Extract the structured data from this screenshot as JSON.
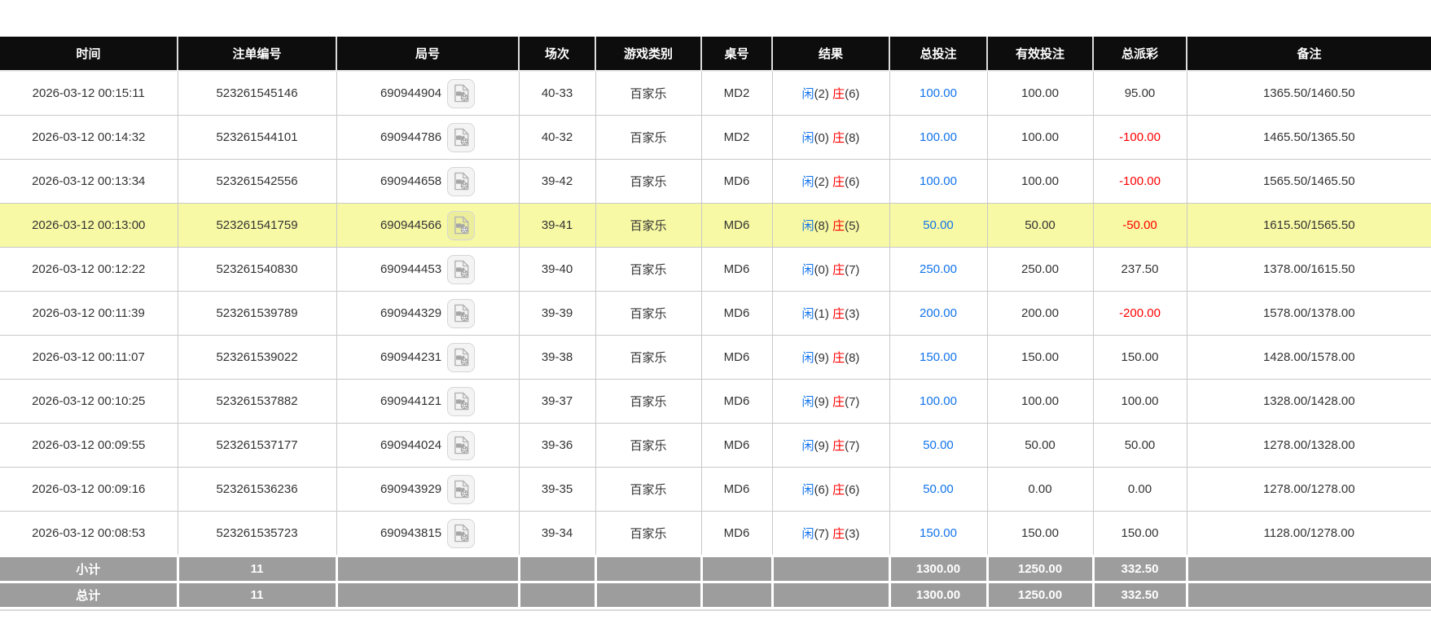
{
  "colors": {
    "bet_blue": "#1273eb",
    "loss_red": "#fe0000",
    "highlight_yellow": "#f8f9a4",
    "header_black": "#0d0d0d",
    "footer_gray": "#9d9d9d"
  },
  "table": {
    "headers": [
      "时间",
      "注单编号",
      "局号",
      "场次",
      "游戏类别",
      "桌号",
      "结果",
      "总投注",
      "有效投注",
      "总派彩",
      "备注"
    ],
    "video_icon": "video-file-icon",
    "rows": [
      {
        "time": "2026-03-12 00:15:11",
        "order_no": "523261545146",
        "round_no": "690944904",
        "session": "40-33",
        "game_type": "百家乐",
        "table_no": "MD2",
        "result": {
          "player_label": "闲",
          "player_score": "(2)",
          "banker_label": "庄",
          "banker_score": "(6)"
        },
        "total_bet": "100.00",
        "valid_bet": "100.00",
        "payout": "95.00",
        "remark": "1365.50/1460.50",
        "highlighted": false
      },
      {
        "time": "2026-03-12 00:14:32",
        "order_no": "523261544101",
        "round_no": "690944786",
        "session": "40-32",
        "game_type": "百家乐",
        "table_no": "MD2",
        "result": {
          "player_label": "闲",
          "player_score": "(0)",
          "banker_label": "庄",
          "banker_score": "(8)"
        },
        "total_bet": "100.00",
        "valid_bet": "100.00",
        "payout": "-100.00",
        "remark": "1465.50/1365.50",
        "highlighted": false
      },
      {
        "time": "2026-03-12 00:13:34",
        "order_no": "523261542556",
        "round_no": "690944658",
        "session": "39-42",
        "game_type": "百家乐",
        "table_no": "MD6",
        "result": {
          "player_label": "闲",
          "player_score": "(2)",
          "banker_label": "庄",
          "banker_score": "(6)"
        },
        "total_bet": "100.00",
        "valid_bet": "100.00",
        "payout": "-100.00",
        "remark": "1565.50/1465.50",
        "highlighted": false
      },
      {
        "time": "2026-03-12 00:13:00",
        "order_no": "523261541759",
        "round_no": "690944566",
        "session": "39-41",
        "game_type": "百家乐",
        "table_no": "MD6",
        "result": {
          "player_label": "闲",
          "player_score": "(8)",
          "banker_label": "庄",
          "banker_score": "(5)"
        },
        "total_bet": "50.00",
        "valid_bet": "50.00",
        "payout": "-50.00",
        "remark": "1615.50/1565.50",
        "highlighted": true
      },
      {
        "time": "2026-03-12 00:12:22",
        "order_no": "523261540830",
        "round_no": "690944453",
        "session": "39-40",
        "game_type": "百家乐",
        "table_no": "MD6",
        "result": {
          "player_label": "闲",
          "player_score": "(0)",
          "banker_label": "庄",
          "banker_score": "(7)"
        },
        "total_bet": "250.00",
        "valid_bet": "250.00",
        "payout": "237.50",
        "remark": "1378.00/1615.50",
        "highlighted": false
      },
      {
        "time": "2026-03-12 00:11:39",
        "order_no": "523261539789",
        "round_no": "690944329",
        "session": "39-39",
        "game_type": "百家乐",
        "table_no": "MD6",
        "result": {
          "player_label": "闲",
          "player_score": "(1)",
          "banker_label": "庄",
          "banker_score": "(3)"
        },
        "total_bet": "200.00",
        "valid_bet": "200.00",
        "payout": "-200.00",
        "remark": "1578.00/1378.00",
        "highlighted": false
      },
      {
        "time": "2026-03-12 00:11:07",
        "order_no": "523261539022",
        "round_no": "690944231",
        "session": "39-38",
        "game_type": "百家乐",
        "table_no": "MD6",
        "result": {
          "player_label": "闲",
          "player_score": "(9)",
          "banker_label": "庄",
          "banker_score": "(8)"
        },
        "total_bet": "150.00",
        "valid_bet": "150.00",
        "payout": "150.00",
        "remark": "1428.00/1578.00",
        "highlighted": false
      },
      {
        "time": "2026-03-12 00:10:25",
        "order_no": "523261537882",
        "round_no": "690944121",
        "session": "39-37",
        "game_type": "百家乐",
        "table_no": "MD6",
        "result": {
          "player_label": "闲",
          "player_score": "(9)",
          "banker_label": "庄",
          "banker_score": "(7)"
        },
        "total_bet": "100.00",
        "valid_bet": "100.00",
        "payout": "100.00",
        "remark": "1328.00/1428.00",
        "highlighted": false
      },
      {
        "time": "2026-03-12 00:09:55",
        "order_no": "523261537177",
        "round_no": "690944024",
        "session": "39-36",
        "game_type": "百家乐",
        "table_no": "MD6",
        "result": {
          "player_label": "闲",
          "player_score": "(9)",
          "banker_label": "庄",
          "banker_score": "(7)"
        },
        "total_bet": "50.00",
        "valid_bet": "50.00",
        "payout": "50.00",
        "remark": "1278.00/1328.00",
        "highlighted": false
      },
      {
        "time": "2026-03-12 00:09:16",
        "order_no": "523261536236",
        "round_no": "690943929",
        "session": "39-35",
        "game_type": "百家乐",
        "table_no": "MD6",
        "result": {
          "player_label": "闲",
          "player_score": "(6)",
          "banker_label": "庄",
          "banker_score": "(6)"
        },
        "total_bet": "50.00",
        "valid_bet": "0.00",
        "payout": "0.00",
        "remark": "1278.00/1278.00",
        "highlighted": false
      },
      {
        "time": "2026-03-12 00:08:53",
        "order_no": "523261535723",
        "round_no": "690943815",
        "session": "39-34",
        "game_type": "百家乐",
        "table_no": "MD6",
        "result": {
          "player_label": "闲",
          "player_score": "(7)",
          "banker_label": "庄",
          "banker_score": "(3)"
        },
        "total_bet": "150.00",
        "valid_bet": "150.00",
        "payout": "150.00",
        "remark": "1128.00/1278.00",
        "highlighted": false
      }
    ],
    "subtotal": {
      "label": "小计",
      "count": "11",
      "total_bet": "1300.00",
      "valid_bet": "1250.00",
      "payout": "332.50"
    },
    "total": {
      "label": "总计",
      "count": "11",
      "total_bet": "1300.00",
      "valid_bet": "1250.00",
      "payout": "332.50"
    }
  }
}
